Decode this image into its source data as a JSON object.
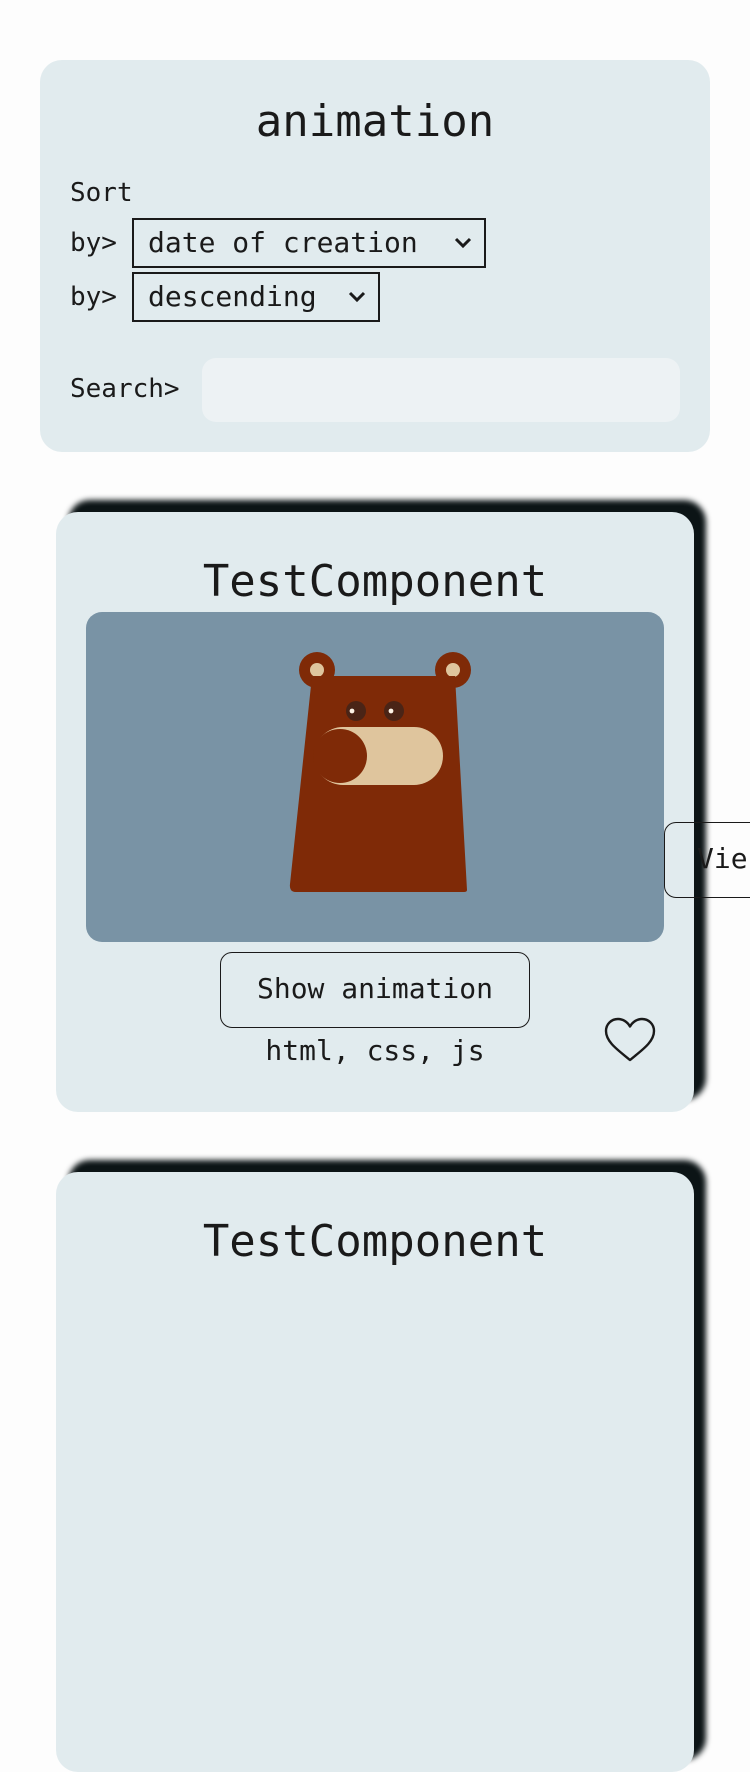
{
  "filters": {
    "title": "animation",
    "sort_label": "Sort",
    "by_label_1": "by>",
    "sort_field_value": "date of creation",
    "by_label_2": "by>",
    "sort_order_value": "descending",
    "search_label": "Search>",
    "search_value": "",
    "search_placeholder": ""
  },
  "cards": [
    {
      "title": "TestComponent",
      "preview_icon": "bear-toggle-animation",
      "show_button_label": "Show animation",
      "tags": "html, css, js",
      "favorite_icon": "heart-icon",
      "view_button_label": "Vie"
    },
    {
      "title": "TestComponent"
    }
  ],
  "colors": {
    "panel_bg": "#e1ebee",
    "preview_bg": "#7993a5",
    "bear_brown": "#7f2a07",
    "bear_light": "#dfc59d",
    "shadow": "#0c1416"
  }
}
